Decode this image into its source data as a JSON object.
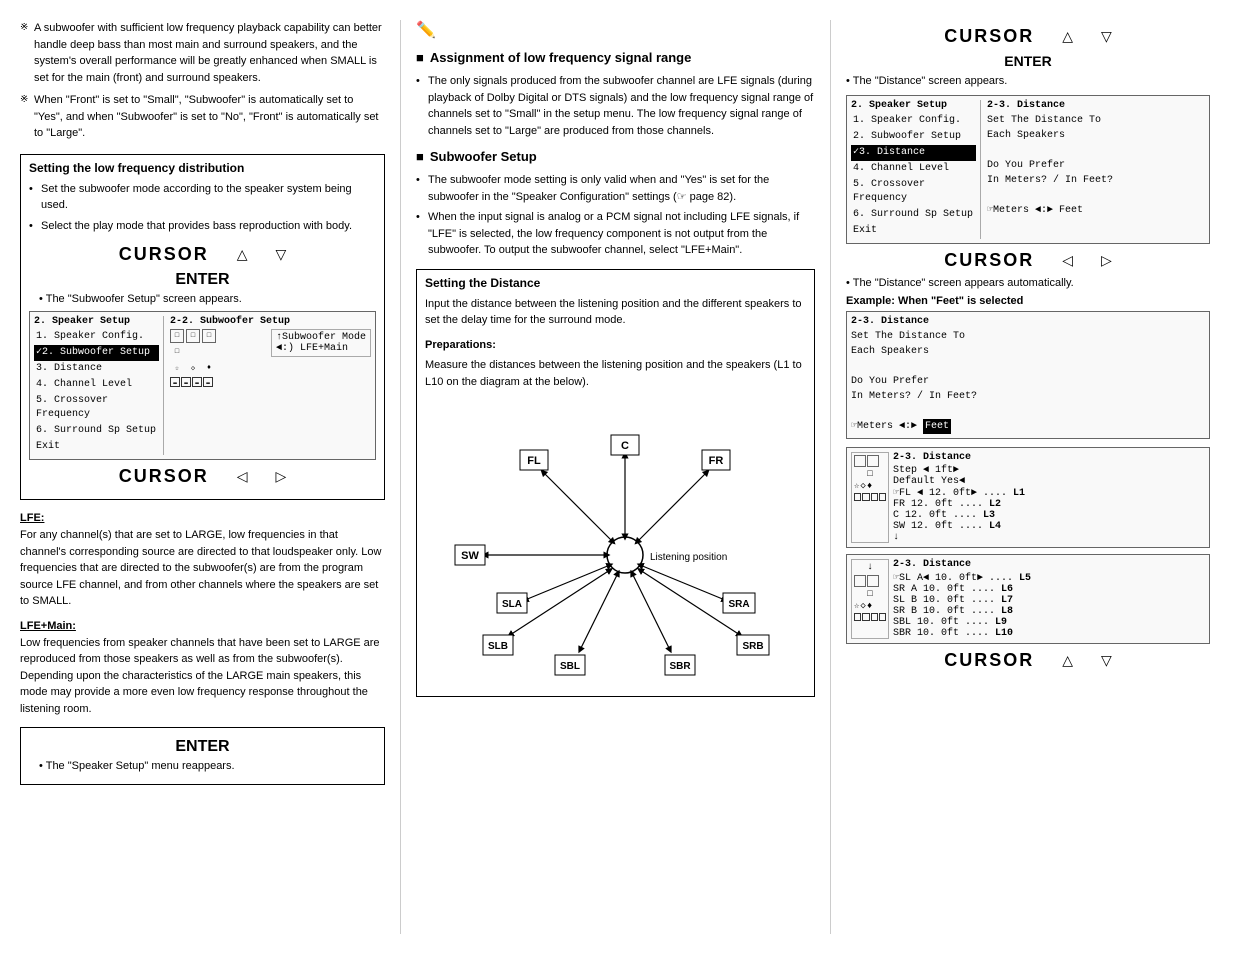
{
  "left_column": {
    "bullets": [
      "A subwoofer with sufficient low frequency playback capability can better handle deep bass than most main and surround speakers, and the system's overall performance will be greatly enhanced when SMALL is set for the main (front) and surround speakers.",
      "When \"Front\" is set to \"Small\", \"Subwoofer\" is automatically set to \"Yes\", and when \"Subwoofer\" is set to \"No\", \"Front\" is automatically set to \"Large\"."
    ],
    "section1": {
      "title": "Setting the low frequency distribution",
      "bullets": [
        "Set the subwoofer mode according to the speaker system being used.",
        "Select the play mode that provides bass reproduction with body."
      ]
    },
    "cursor1": {
      "text": "CURSOR",
      "up": "△",
      "down": "▽"
    },
    "enter1": {
      "text": "ENTER",
      "note": "The \"Subwoofer Setup\" screen appears."
    },
    "menu1": {
      "header": "2. Speaker Setup",
      "items": [
        "1. Speaker Config.",
        "✓2. Subwoofer Setup",
        "3. Distance",
        "4. Channel Level",
        "5. Crossover Frequency",
        "6. Surround Sp Setup",
        "",
        "Exit"
      ],
      "right_header": "2-2. Subwoofer Setup",
      "right_content": "↑Subwoofer Mode\n◄:) LFE+Main"
    },
    "cursor2": {
      "text": "CURSOR",
      "left": "◁",
      "right": "▷"
    },
    "lfe": {
      "title": "LFE:",
      "body": "For any channel(s) that are set to LARGE, low frequencies in that channel's corresponding source are directed to that loudspeaker only. Low frequencies that are directed to the subwoofer(s) are from the program source LFE channel, and from other channels where the speakers are set to SMALL."
    },
    "lfe_main": {
      "title": "LFE+Main:",
      "body": "Low frequencies from speaker channels that have been set to LARGE are reproduced from those speakers as well as from the subwoofer(s). Depending upon the characteristics of the LARGE main speakers, this mode may provide a more even low frequency response throughout the listening room."
    },
    "enter2": {
      "text": "ENTER",
      "note": "The \"Speaker Setup\" menu reappears."
    }
  },
  "middle_column": {
    "section_alf": {
      "title": "Assignment of low frequency signal range",
      "bullets": [
        "The only signals produced from the subwoofer channel are LFE signals (during playback of Dolby Digital or DTS signals) and the low frequency signal range of channels set to \"Small\" in the setup menu. The low frequency signal range of channels set to \"Large\" are produced from those channels."
      ]
    },
    "section_sub": {
      "title": "Subwoofer Setup",
      "bullets": [
        "The subwoofer mode setting is only valid when and \"Yes\" is set for the subwoofer in the \"Speaker Configuration\" settings (☞ page 82).",
        "When the input signal is analog or a PCM signal not including LFE signals, if \"LFE\" is selected, the low frequency component is not output from the subwoofer. To output the subwoofer channel, select \"LFE+Main\"."
      ]
    },
    "section_dist": {
      "title": "Setting the Distance",
      "intro": "Input the distance between the listening position and the different speakers to set the delay time for the surround mode.",
      "prep_title": "Preparations:",
      "prep_body": "Measure the distances between the listening position and the speakers (L1 to L10 on the diagram at the below)."
    },
    "diagram": {
      "labels": {
        "fl": "FL",
        "c": "C",
        "fr": "FR",
        "sw": "SW",
        "sla": "SLA",
        "sra": "SRA",
        "slb": "SLB",
        "srb": "SRB",
        "sbl": "SBL",
        "sbr": "SBR",
        "listening": "Listening position"
      }
    }
  },
  "right_column": {
    "cursor1": {
      "text": "CURSOR",
      "up": "△",
      "down": "▽"
    },
    "enter1": {
      "text": "ENTER",
      "note": "The \"Distance\" screen appears."
    },
    "menu1": {
      "header": "2. Speaker Setup",
      "items": [
        "1. Speaker Config.",
        "2. Subwoofer Setup",
        "✓3. Distance",
        "4. Channel Level",
        "5. Crossover Frequency",
        "6. Surround Sp Setup",
        "",
        "Exit"
      ],
      "right_header": "2-3. Distance",
      "right_lines": [
        "Set The Distance To",
        "Each Speakers",
        "",
        "Do You Prefer",
        "In Meters? / In Feet?",
        "",
        "☞Meters ◄:► Feet"
      ]
    },
    "cursor2": {
      "text": "CURSOR",
      "left": "◁",
      "right": "▷"
    },
    "note2": "The \"Distance\" screen appears automatically.",
    "example_label": "Example: When \"Feet\" is selected",
    "example_screen": {
      "header": "2-3. Distance",
      "lines": [
        "Set The Distance To",
        "Each Speakers",
        "",
        "Do You Prefer",
        "In Meters? / In Feet?",
        "",
        "☞Meters ◄:► Feet"
      ],
      "feet_highlighted": true
    },
    "dist_table1": {
      "header": "2-3. Distance",
      "step": "Step ◄  1ft►",
      "default": "Default  Yes◄",
      "rows": [
        {
          "label": "☞FL",
          "val": "◄ 12. 0ft►",
          "l": "L1"
        },
        {
          "label": "FR",
          "val": "12. 0ft",
          "l": "L2"
        },
        {
          "label": "C",
          "val": "12. 0ft",
          "l": "L3"
        },
        {
          "label": "SW",
          "val": "12. 0ft",
          "l": "L4"
        }
      ]
    },
    "dist_table2": {
      "header": "2-3. Distance",
      "rows": [
        {
          "label": "☞SL A◄",
          "val": "10. 0ft►",
          "l": "L5"
        },
        {
          "label": "SR A",
          "val": "10. 0ft",
          "l": "L6"
        },
        {
          "label": "SL B",
          "val": "10. 0ft",
          "l": "L7"
        },
        {
          "label": "SR B",
          "val": "10. 0ft",
          "l": "L8"
        },
        {
          "label": "SBL",
          "val": "10. 0ft",
          "l": "L9"
        },
        {
          "label": "SBR",
          "val": "10. 0ft",
          "l": "L10"
        }
      ]
    },
    "cursor3": {
      "text": "CURSOR",
      "up": "△",
      "down": "▽"
    }
  }
}
